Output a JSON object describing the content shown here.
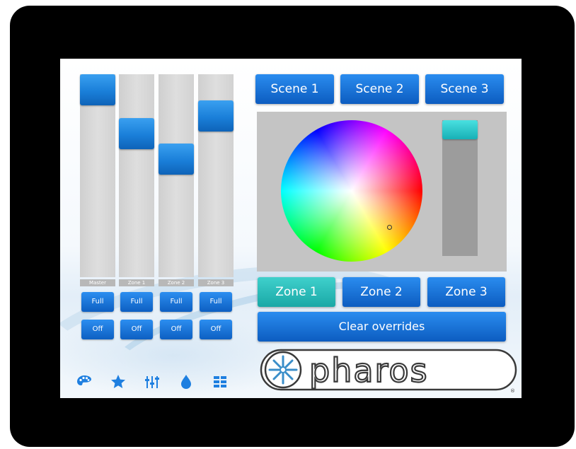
{
  "faders": [
    {
      "label": "Master",
      "level": 1.0,
      "full_label": "Full",
      "off_label": "Off"
    },
    {
      "label": "Zone 1",
      "level": 0.75,
      "full_label": "Full",
      "off_label": "Off"
    },
    {
      "label": "Zone 2",
      "level": 0.6,
      "full_label": "Full",
      "off_label": "Off"
    },
    {
      "label": "Zone 3",
      "level": 0.85,
      "full_label": "Full",
      "off_label": "Off"
    }
  ],
  "scenes": [
    "Scene 1",
    "Scene 2",
    "Scene 3"
  ],
  "zones": {
    "items": [
      "Zone 1",
      "Zone 2",
      "Zone 3"
    ],
    "selected": "Zone 1"
  },
  "clear_label": "Clear overrides",
  "brand": "pharos",
  "colors": {
    "button_blue": "#1a72d6",
    "active_teal": "#2bc0be",
    "panel_grey": "#c4c4c4",
    "bezel": "#000000"
  },
  "nav_icons": [
    "palette-icon",
    "star-icon",
    "sliders-icon",
    "drop-icon",
    "grid-icon"
  ]
}
